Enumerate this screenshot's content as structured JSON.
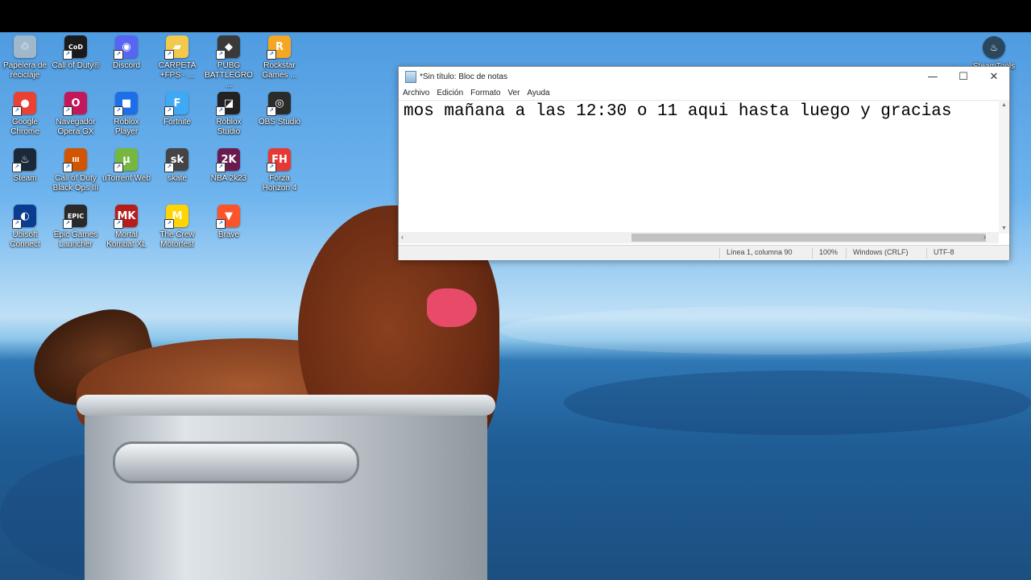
{
  "desktop": {
    "icons": [
      {
        "label": "Papelera de reciclaje",
        "icon": "recycle-bin-icon",
        "color": "#9fb8cc",
        "glyph": "♲"
      },
      {
        "label": "Call of Duty®",
        "icon": "call-of-duty-icon",
        "color": "#1a1a1a",
        "glyph": "CoD"
      },
      {
        "label": "Discord",
        "icon": "discord-icon",
        "color": "#5865f2",
        "glyph": "◉"
      },
      {
        "label": "CARPETA +FPS - ...",
        "icon": "folder-icon",
        "color": "#f2c94c",
        "glyph": "▰"
      },
      {
        "label": "PUBG BATTLEGRO...",
        "icon": "pubg-icon",
        "color": "#3a3a3a",
        "glyph": "◆"
      },
      {
        "label": "Rockstar Games ...",
        "icon": "rockstar-icon",
        "color": "#f5a623",
        "glyph": "R"
      },
      {
        "label": "Google Chrome",
        "icon": "chrome-icon",
        "color": "#e94235",
        "glyph": "●"
      },
      {
        "label": "Navegador Opera GX",
        "icon": "opera-gx-icon",
        "color": "#c2185b",
        "glyph": "O"
      },
      {
        "label": "Roblox Player",
        "icon": "roblox-player-icon",
        "color": "#1d6ee8",
        "glyph": "■"
      },
      {
        "label": "Fortnite",
        "icon": "fortnite-icon",
        "color": "#3fa9f5",
        "glyph": "F"
      },
      {
        "label": "Roblox Studio",
        "icon": "roblox-studio-icon",
        "color": "#222222",
        "glyph": "◪"
      },
      {
        "label": "OBS Studio",
        "icon": "obs-icon",
        "color": "#2b2b2b",
        "glyph": "◎"
      },
      {
        "label": "Steam",
        "icon": "steam-icon",
        "color": "#1b2838",
        "glyph": "♨"
      },
      {
        "label": "Call of Duty Black Ops III",
        "icon": "black-ops-iii-icon",
        "color": "#d35400",
        "glyph": "III"
      },
      {
        "label": "uTorrent Web",
        "icon": "utorrent-icon",
        "color": "#76b83f",
        "glyph": "µ"
      },
      {
        "label": "skate",
        "icon": "skate-icon",
        "color": "#444444",
        "glyph": "sk"
      },
      {
        "label": "NBA 2k23",
        "icon": "nba-2k23-icon",
        "color": "#6a1b4d",
        "glyph": "2K"
      },
      {
        "label": "Forza Horizon 4",
        "icon": "forza-icon",
        "color": "#e53935",
        "glyph": "FH"
      },
      {
        "label": "Ubisoft Connect",
        "icon": "ubisoft-icon",
        "color": "#0a3d91",
        "glyph": "◐"
      },
      {
        "label": "Epic Games Launcher",
        "icon": "epic-games-icon",
        "color": "#2a2a2a",
        "glyph": "EPIC"
      },
      {
        "label": "Mortal Kombat XL",
        "icon": "mortal-kombat-icon",
        "color": "#b71c1c",
        "glyph": "MK"
      },
      {
        "label": "The Crew Motorfest",
        "icon": "the-crew-icon",
        "color": "#ffd400",
        "glyph": "M"
      },
      {
        "label": "Brave",
        "icon": "brave-icon",
        "color": "#fb542b",
        "glyph": "▼"
      }
    ],
    "right_icon": {
      "label": "SteamTools",
      "icon": "steamtools-icon",
      "color": "#2a475e",
      "glyph": "♨"
    }
  },
  "notepad": {
    "title": "*Sin título: Bloc de notas",
    "controls": {
      "minimize": "—",
      "maximize": "☐",
      "close": "✕"
    },
    "menu": [
      "Archivo",
      "Edición",
      "Formato",
      "Ver",
      "Ayuda"
    ],
    "content": "mos mañana a las 12:30 o 11 aqui hasta luego y gracias",
    "status": {
      "position": "Línea 1, columna 90",
      "zoom": "100%",
      "line_endings": "Windows (CRLF)",
      "encoding": "UTF-8"
    }
  }
}
